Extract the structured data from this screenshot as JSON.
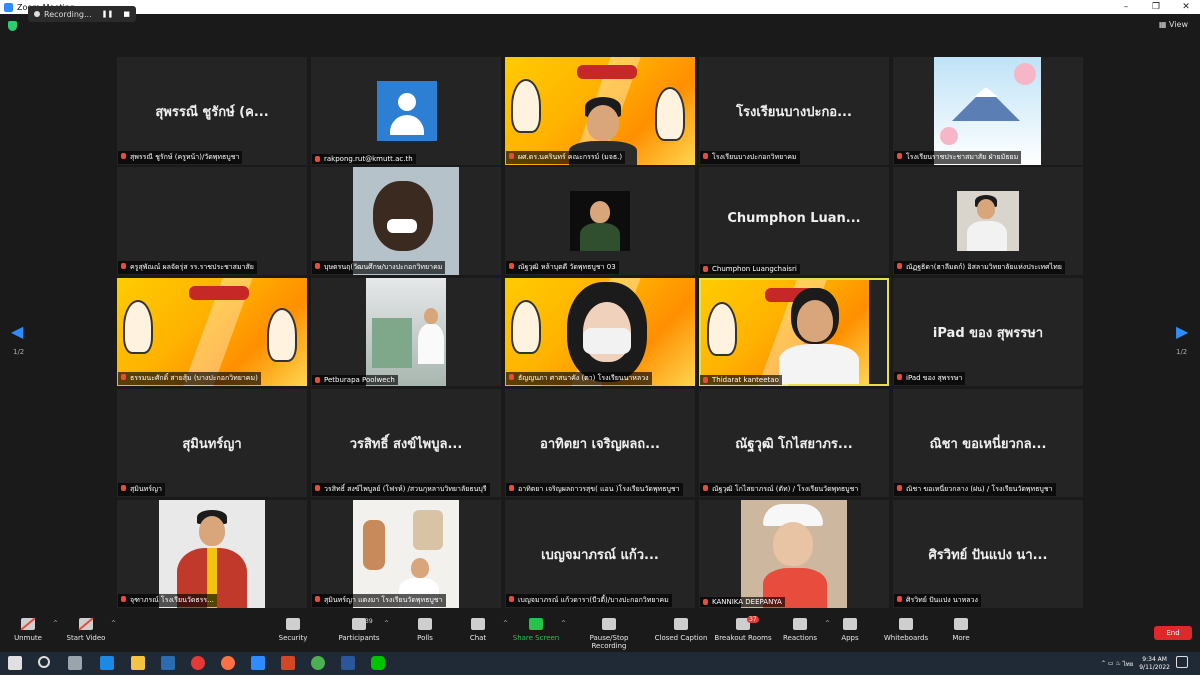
{
  "window": {
    "title": "Zoom Meeting",
    "view_label": "View"
  },
  "recording": {
    "label": "Recording..."
  },
  "pages": {
    "left": "1/2",
    "right": "1/2"
  },
  "tiles": [
    {
      "display": "สุพรรณี ชูรักษ์ (ค...",
      "label": "สุพรรณี ชูรักษ์ (ครูหน้า)/วัดพุทธบูชา"
    },
    {
      "label": "rakpong.rut@kmutt.ac.th"
    },
    {
      "label": "ผศ.ดร.นครินทร์ คณะกรรม์ (มจธ.)"
    },
    {
      "display": "โรงเรียนบางปะกอ...",
      "label": "โรงเรียนบางปะกอกวิทยาคม"
    },
    {
      "label": "โรงเรียนราชประชาสมาสัย ฝ่ายมัธยม"
    },
    {
      "label": "ครูสุพัณณ์ ผลจัดรุ่ส รร.ราชประชาสมาสัย"
    },
    {
      "label": "บุษตรนฤ(วัฒนศึกษ/บางปะกอกวิทยาคม"
    },
    {
      "label": "ณัฐวุฒิ หล้าบุตดี วัดพุทธบูชา 03"
    },
    {
      "display": "Chumphon  Luan...",
      "label": "Chumphon Luangchaisri"
    },
    {
      "label": "ณัฏฐธิดา(ฮาลีมตก์) อิสลามวิทยาลัยแห่งประเทศไทย"
    },
    {
      "label": "ธรรมนะศักดิ์ สายสุ้ม (บางปะกอกวิทยาคม)"
    },
    {
      "label": "Petburapa Poolwech"
    },
    {
      "label": "ธัญญนภา ศาสนาคัง (ตา) โรงเรียนนาหลวง"
    },
    {
      "label": "Thidarat kanteetao"
    },
    {
      "display": "iPad ของ สุพรรษา",
      "label": "iPad ของ สุพรรษา"
    },
    {
      "display": "สุมินทร์ญา",
      "label": "สุมินทร์ญา"
    },
    {
      "display": "วรสิทธิ์ สงข์ไพบูล...",
      "label": "วรสิทธิ์ สงข์ไพบูลย์ (โฟรห์) /สวนกุหลาบวิทยาลัยธนบุรี"
    },
    {
      "display": "อาทิตยา เจริญผลถ...",
      "label": "อาทิตยา เจริญผลถาวรสุข( แอน )โรงเรียนวัดพุทธบูชา"
    },
    {
      "display": "ณัฐวุฒิ โกไสยาภร...",
      "label": "ณัฐวุฒิ โกไสยาภรณ์ (ตัท) / โรงเรียนวัดพุทธบูชา"
    },
    {
      "display": "ณิชา ขอเหนี่ยวกล...",
      "label": "ณิชา ขอเหนี่ยวกลาง (ฝน) / โรงเรียนวัดพุทธบูชา"
    },
    {
      "label": "จุฑาภรณ์ โรงเรียนวัดธรร..."
    },
    {
      "label": "สุมินทร์ญา แตงมา โรงเรียนวัดพุทธบูชา"
    },
    {
      "display": "เบญจมาภรณ์ แก้ว...",
      "label": "เบญจมาภรณ์ แก้วดารา(บีวตี้)/บางปะกอกวิทยาคม"
    },
    {
      "label": "KANNIKA DEEPANYA"
    },
    {
      "display": "ศิรวิทย์ ปันแปง นา...",
      "label": "ศิรวิทย์ ปันแปง นาหลวง"
    }
  ],
  "toolbar": {
    "unmute": "Unmute",
    "start_video": "Start Video",
    "security": "Security",
    "participants": "Participants",
    "participants_count": "39",
    "polls": "Polls",
    "chat": "Chat",
    "share": "Share Screen",
    "record": "Pause/Stop Recording",
    "caption": "Closed Caption",
    "breakout": "Breakout Rooms",
    "breakout_count": "37",
    "reactions": "Reactions",
    "apps": "Apps",
    "whiteboards": "Whiteboards",
    "more": "More",
    "end": "End"
  },
  "taskbar": {
    "lang": "ไทย",
    "time": "9:34 AM",
    "date": "9/11/2022"
  }
}
